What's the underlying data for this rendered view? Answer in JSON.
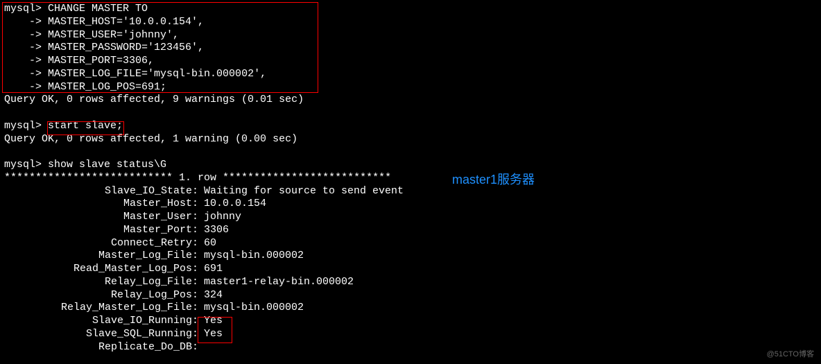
{
  "prompt1": "mysql>",
  "prompt2": "    ->",
  "cmd1": {
    "l1": " CHANGE MASTER TO",
    "l2": " MASTER_HOST='10.0.0.154',",
    "l3": " MASTER_USER='johnny',",
    "l4": " MASTER_PASSWORD='123456',",
    "l5": " MASTER_PORT=3306,",
    "l6": " MASTER_LOG_FILE='mysql-bin.000002',",
    "l7": " MASTER_LOG_POS=691;"
  },
  "result1": "Query OK, 0 rows affected, 9 warnings (0.01 sec)",
  "cmd2": " start slave;",
  "result2": "Query OK, 0 rows affected, 1 warning (0.00 sec)",
  "cmd3": " show slave status\\G",
  "rowheader": "*************************** 1. row ***************************",
  "status": {
    "Slave_IO_State": "Waiting for source to send event",
    "Master_Host": "10.0.0.154",
    "Master_User": "johnny",
    "Master_Port": "3306",
    "Connect_Retry": "60",
    "Master_Log_File": "mysql-bin.000002",
    "Read_Master_Log_Pos": "691",
    "Relay_Log_File": "master1-relay-bin.000002",
    "Relay_Log_Pos": "324",
    "Relay_Master_Log_File": "mysql-bin.000002",
    "Slave_IO_Running": "Yes",
    "Slave_SQL_Running": "Yes",
    "Replicate_Do_DB": ""
  },
  "labels": {
    "Slave_IO_State": "Slave_IO_State:",
    "Master_Host": "Master_Host:",
    "Master_User": "Master_User:",
    "Master_Port": "Master_Port:",
    "Connect_Retry": "Connect_Retry:",
    "Master_Log_File": "Master_Log_File:",
    "Read_Master_Log_Pos": "Read_Master_Log_Pos:",
    "Relay_Log_File": "Relay_Log_File:",
    "Relay_Log_Pos": "Relay_Log_Pos:",
    "Relay_Master_Log_File": "Relay_Master_Log_File:",
    "Slave_IO_Running": "Slave_IO_Running:",
    "Slave_SQL_Running": "Slave_SQL_Running:",
    "Replicate_Do_DB": "Replicate_Do_DB:"
  },
  "annotation": "master1服务器",
  "watermark": "@51CTO博客"
}
